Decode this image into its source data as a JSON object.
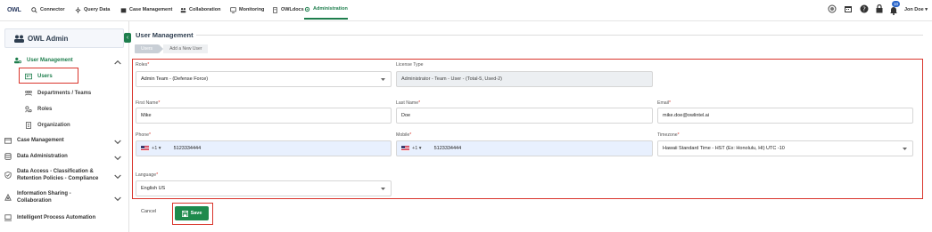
{
  "app": {
    "logo_text": "OWL"
  },
  "topnav": {
    "items": [
      {
        "label": "Connector",
        "icon": "search-icon"
      },
      {
        "label": "Query Data",
        "icon": "sliders-icon"
      },
      {
        "label": "Case Management",
        "icon": "folder-icon"
      },
      {
        "label": "Collaboration",
        "icon": "people-icon"
      },
      {
        "label": "Monitoring",
        "icon": "monitor-icon"
      },
      {
        "label": "OWLdocs",
        "icon": "docs-icon"
      },
      {
        "label": "Administration",
        "icon": "admin-icon",
        "active": true
      }
    ],
    "notification_count": "10",
    "user_name": "Jon Doe"
  },
  "sidebar": {
    "title": "OWL Admin",
    "items": [
      {
        "label": "User Management",
        "expanded": true
      },
      {
        "label": "Users",
        "active": true
      },
      {
        "label": "Departments / Teams"
      },
      {
        "label": "Roles"
      },
      {
        "label": "Organization"
      },
      {
        "label": "Case Management"
      },
      {
        "label": "Data Administration"
      },
      {
        "label": "Data Access - Classification &",
        "label2": "Retention Policies - Compliance"
      },
      {
        "label": "Information Sharing -",
        "label2": "Collaboration"
      },
      {
        "label": "Intelligent Process Automation"
      }
    ]
  },
  "page": {
    "title": "User Management",
    "breadcrumb": [
      "Users",
      "Add a New User"
    ]
  },
  "form": {
    "roles": {
      "label": "Roles",
      "value": "Admin Team - (Defense Force)"
    },
    "license": {
      "label": "License Type",
      "value": "Administrator - Team - User - (Total-5, Used-2)"
    },
    "first_name": {
      "label": "First Name",
      "value": "Mike"
    },
    "last_name": {
      "label": "Last Name",
      "value": "Doe"
    },
    "email": {
      "label": "Email",
      "value": "mike.doe@owlintel.ai"
    },
    "phone": {
      "label": "Phone",
      "code": "+1",
      "value": "5123334444"
    },
    "mobile": {
      "label": "Mobile",
      "code": "+1",
      "value": "5123334444"
    },
    "timezone": {
      "label": "Timezone",
      "value": "Hawaii Standard Time - HST (Ex: Honolulu, HI) UTC -10"
    },
    "language": {
      "label": "Language",
      "value": "English US"
    }
  },
  "actions": {
    "cancel": "Cancel",
    "save": "Save"
  },
  "colors": {
    "accent": "#1e7e4d",
    "highlight": "#d9342b",
    "navy": "#2d3d4f"
  }
}
